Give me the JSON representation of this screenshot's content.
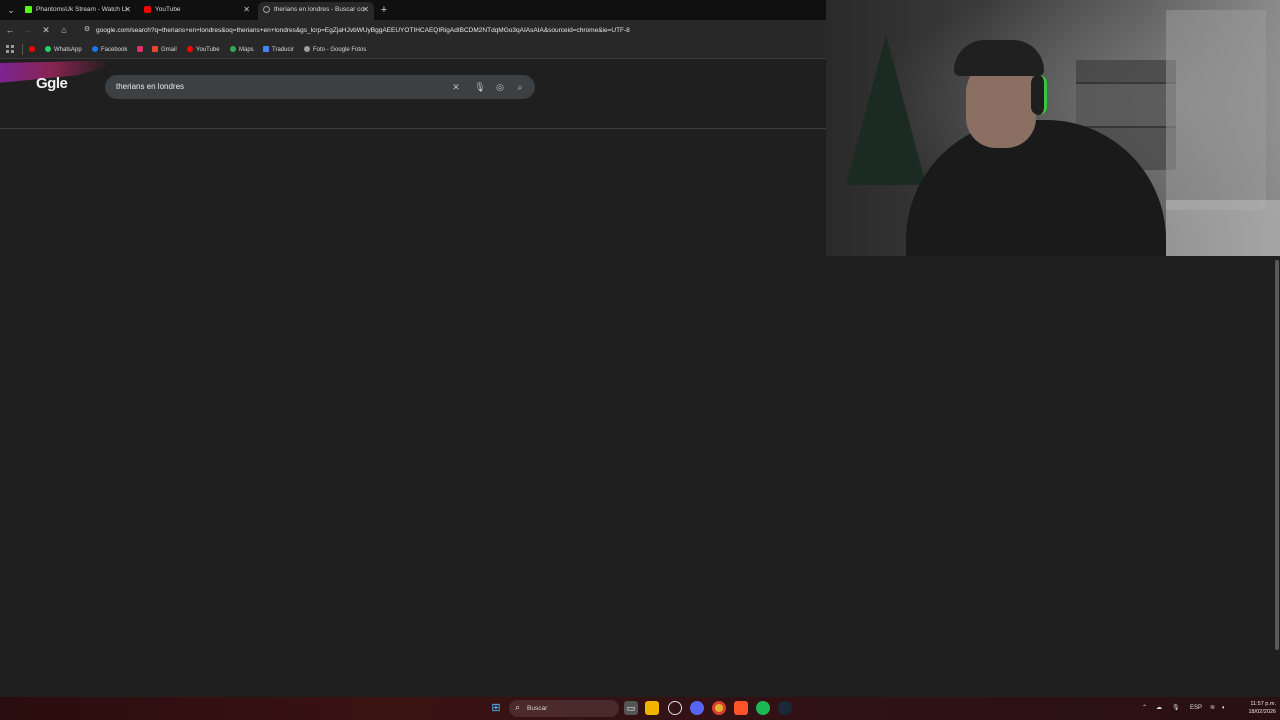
{
  "tabs": [
    {
      "label": "PhantomsUk Stream - Watch Li",
      "favicon_color": "#53fc18",
      "active": false
    },
    {
      "label": "YouTube",
      "favicon_color": "#ff0000",
      "active": false
    },
    {
      "label": "therians en londres - Buscar co",
      "favicon_color": "#9aa0a6",
      "active": true
    }
  ],
  "toolbar": {
    "url": "google.com/search?q=therians+en+londres&oq=therians+en+londres&gs_lcrp=EgZjaHJvbWUyBggAEEUYOTIHCAEQIRigAdIBCDM2NTdqMGo3qAIAsAIA&sourceid=chrome&ie=UTF-8"
  },
  "bookmarks": [
    {
      "label": "",
      "color": "#ff0000"
    },
    {
      "label": "WhatsApp",
      "color": "#25d366"
    },
    {
      "label": "Facebook",
      "color": "#1877f2"
    },
    {
      "label": "",
      "color": "#e1306c"
    },
    {
      "label": "Gmail",
      "color": "#ea4335"
    },
    {
      "label": "YouTube",
      "color": "#ff0000"
    },
    {
      "label": "Maps",
      "color": "#34a853"
    },
    {
      "label": "Traducir",
      "color": "#4285f4"
    },
    {
      "label": "Foto - Google Fotos",
      "color": "#fbbc04"
    }
  ],
  "google": {
    "logo_text": "Ggle",
    "query": "therians en londres"
  },
  "taskbar": {
    "search_label": "Buscar",
    "language": "ESP",
    "time": "11:57 p.m.",
    "date": "18/02/2026"
  },
  "colors": {
    "page_bg": "#1f1f1f",
    "toolbar_bg": "#282828",
    "tabstrip_bg": "#101010",
    "searchbox_bg": "#3c4043"
  }
}
